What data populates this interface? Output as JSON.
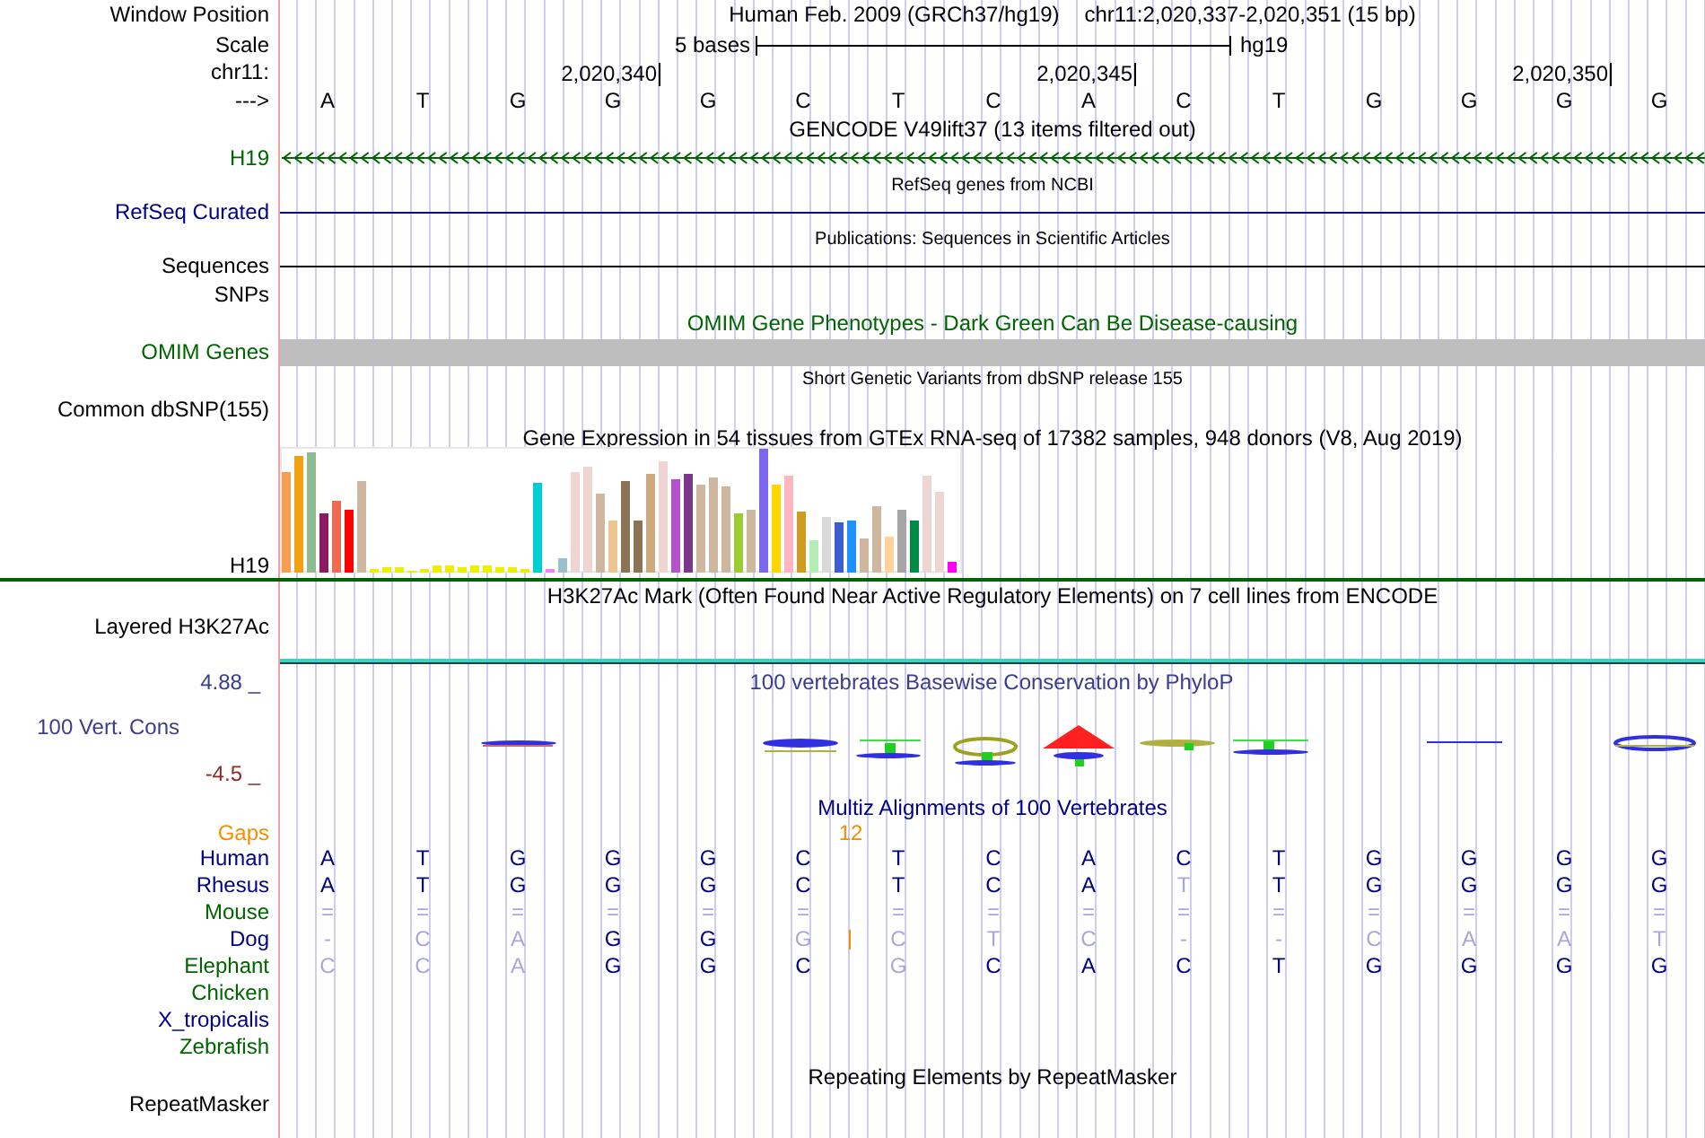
{
  "header": {
    "position_label": "Window Position",
    "assembly_name": "Human Feb. 2009 (GRCh37/hg19)",
    "location": "chr11:2,020,337-2,020,351 (15 bp)",
    "scale_label": "Scale",
    "scale_text": "5 bases",
    "assembly": "hg19",
    "chrom_label": "chr11:",
    "ticks": [
      "2,020,340",
      "2,020,345",
      "2,020,350"
    ],
    "strand_label": "--->",
    "bases": [
      "A",
      "T",
      "G",
      "G",
      "G",
      "C",
      "T",
      "C",
      "A",
      "C",
      "T",
      "G",
      "G",
      "G",
      "G"
    ]
  },
  "tracks": [
    {
      "kind": "gene",
      "title": {
        "text": "GENCODE V49lift37 (13 items filtered out)",
        "color": "#000000"
      },
      "label": "H19",
      "color": "#006400"
    },
    {
      "kind": "line",
      "title": {
        "text": "RefSeq genes from NCBI",
        "color": "#000000"
      },
      "label": "RefSeq Curated",
      "color": "#000080"
    },
    {
      "kind": "line",
      "title": {
        "text": "Publications: Sequences in Scientific Articles",
        "color": "#000000"
      },
      "label": "Sequences",
      "color": "#000000"
    },
    {
      "kind": "label",
      "label": "SNPs",
      "color": "#000000"
    },
    {
      "kind": "bar",
      "title": {
        "text": "OMIM Gene Phenotypes - Dark Green Can Be Disease-causing",
        "color": "#006400"
      },
      "label": "OMIM Genes",
      "color": "#006400"
    },
    {
      "kind": "snp",
      "title": {
        "text": "Short Genetic Variants from dbSNP release 155",
        "color": "#000000"
      },
      "label": "Common dbSNP(155)",
      "color": "#000000"
    },
    {
      "kind": "chart",
      "title": {
        "text": "Gene Expression in 54 tissues from GTEx RNA-seq of 17382 samples, 948 donors (V8, Aug 2019)",
        "color": "#000000"
      },
      "label": "H19",
      "color": "#000000"
    },
    {
      "kind": "signal",
      "title": {
        "text": "H3K27Ac Mark (Often Found Near Active Regulatory Elements) on 7 cell lines from ENCODE",
        "color": "#000000"
      },
      "label": "Layered H3K27Ac",
      "color": "#000000"
    },
    {
      "kind": "conservation",
      "title": {
        "text": "100 vertebrates Basewise Conservation by PhyloP",
        "color": "#3c3c8c"
      },
      "label": "100 Vert. Cons",
      "color": "#3c3c8c",
      "max": "4.88 _",
      "min": "-4.5 _"
    },
    {
      "kind": "alignment",
      "title": {
        "text": "Multiz Alignments of 100 Vertebrates",
        "color": "#000080"
      },
      "gaps": {
        "label": "Gaps",
        "text": "12"
      },
      "species": [
        {
          "name": "Human",
          "color": "#000080",
          "bases": [
            {
              "text": "A",
              "faded": false,
              "insert_after": false
            },
            {
              "text": "T",
              "faded": false,
              "insert_after": false
            },
            {
              "text": "G",
              "faded": false,
              "insert_after": false
            },
            {
              "text": "G",
              "faded": false,
              "insert_after": false
            },
            {
              "text": "G",
              "faded": false,
              "insert_after": false
            },
            {
              "text": "C",
              "faded": false,
              "insert_after": false
            },
            {
              "text": "T",
              "faded": false,
              "insert_after": false
            },
            {
              "text": "C",
              "faded": false,
              "insert_after": false
            },
            {
              "text": "A",
              "faded": false,
              "insert_after": false
            },
            {
              "text": "C",
              "faded": false,
              "insert_after": false
            },
            {
              "text": "T",
              "faded": false,
              "insert_after": false
            },
            {
              "text": "G",
              "faded": false,
              "insert_after": false
            },
            {
              "text": "G",
              "faded": false,
              "insert_after": false
            },
            {
              "text": "G",
              "faded": false,
              "insert_after": false
            },
            {
              "text": "G",
              "faded": false,
              "insert_after": false
            }
          ]
        },
        {
          "name": "Rhesus",
          "color": "#000080",
          "bases": [
            {
              "text": "A",
              "faded": false,
              "insert_after": false
            },
            {
              "text": "T",
              "faded": false,
              "insert_after": false
            },
            {
              "text": "G",
              "faded": false,
              "insert_after": false
            },
            {
              "text": "G",
              "faded": false,
              "insert_after": false
            },
            {
              "text": "G",
              "faded": false,
              "insert_after": false
            },
            {
              "text": "C",
              "faded": false,
              "insert_after": false
            },
            {
              "text": "T",
              "faded": false,
              "insert_after": false
            },
            {
              "text": "C",
              "faded": false,
              "insert_after": false
            },
            {
              "text": "A",
              "faded": false,
              "insert_after": false
            },
            {
              "text": "T",
              "faded": true,
              "insert_after": false
            },
            {
              "text": "T",
              "faded": false,
              "insert_after": false
            },
            {
              "text": "G",
              "faded": false,
              "insert_after": false
            },
            {
              "text": "G",
              "faded": false,
              "insert_after": false
            },
            {
              "text": "G",
              "faded": false,
              "insert_after": false
            },
            {
              "text": "G",
              "faded": false,
              "insert_after": false
            }
          ]
        },
        {
          "name": "Mouse",
          "color": "#006400",
          "bases": [
            {
              "text": "=",
              "faded": true,
              "insert_after": false
            },
            {
              "text": "=",
              "faded": true,
              "insert_after": false
            },
            {
              "text": "=",
              "faded": true,
              "insert_after": false
            },
            {
              "text": "=",
              "faded": true,
              "insert_after": false
            },
            {
              "text": "=",
              "faded": true,
              "insert_after": false
            },
            {
              "text": "=",
              "faded": true,
              "insert_after": false
            },
            {
              "text": "=",
              "faded": true,
              "insert_after": false
            },
            {
              "text": "=",
              "faded": true,
              "insert_after": false
            },
            {
              "text": "=",
              "faded": true,
              "insert_after": false
            },
            {
              "text": "=",
              "faded": true,
              "insert_after": false
            },
            {
              "text": "=",
              "faded": true,
              "insert_after": false
            },
            {
              "text": "=",
              "faded": true,
              "insert_after": false
            },
            {
              "text": "=",
              "faded": true,
              "insert_after": false
            },
            {
              "text": "=",
              "faded": true,
              "insert_after": false
            },
            {
              "text": "=",
              "faded": true,
              "insert_after": false
            }
          ]
        },
        {
          "name": "Dog",
          "color": "#000080",
          "bases": [
            {
              "text": "-",
              "faded": true,
              "insert_after": false
            },
            {
              "text": "C",
              "faded": true,
              "insert_after": false
            },
            {
              "text": "A",
              "faded": true,
              "insert_after": false
            },
            {
              "text": "G",
              "faded": false,
              "insert_after": false
            },
            {
              "text": "G",
              "faded": false,
              "insert_after": false
            },
            {
              "text": "G",
              "faded": true,
              "insert_after": true
            },
            {
              "text": "C",
              "faded": true,
              "insert_after": false
            },
            {
              "text": "T",
              "faded": true,
              "insert_after": false
            },
            {
              "text": "C",
              "faded": true,
              "insert_after": false
            },
            {
              "text": "-",
              "faded": true,
              "insert_after": false
            },
            {
              "text": "-",
              "faded": true,
              "insert_after": false
            },
            {
              "text": "C",
              "faded": true,
              "insert_after": false
            },
            {
              "text": "A",
              "faded": true,
              "insert_after": false
            },
            {
              "text": "A",
              "faded": true,
              "insert_after": false
            },
            {
              "text": "T",
              "faded": true,
              "insert_after": false
            }
          ]
        },
        {
          "name": "Elephant",
          "color": "#006400",
          "bases": [
            {
              "text": "C",
              "faded": true,
              "insert_after": false
            },
            {
              "text": "C",
              "faded": true,
              "insert_after": false
            },
            {
              "text": "A",
              "faded": true,
              "insert_after": false
            },
            {
              "text": "G",
              "faded": false,
              "insert_after": false
            },
            {
              "text": "G",
              "faded": false,
              "insert_after": false
            },
            {
              "text": "C",
              "faded": false,
              "insert_after": false
            },
            {
              "text": "G",
              "faded": true,
              "insert_after": false
            },
            {
              "text": "C",
              "faded": false,
              "insert_after": false
            },
            {
              "text": "A",
              "faded": false,
              "insert_after": false
            },
            {
              "text": "C",
              "faded": false,
              "insert_after": false
            },
            {
              "text": "T",
              "faded": false,
              "insert_after": false
            },
            {
              "text": "G",
              "faded": false,
              "insert_after": false
            },
            {
              "text": "G",
              "faded": false,
              "insert_after": false
            },
            {
              "text": "G",
              "faded": false,
              "insert_after": false
            },
            {
              "text": "G",
              "faded": false,
              "insert_after": false
            }
          ]
        },
        {
          "name": "Chicken",
          "color": "#006400"
        },
        {
          "name": "X_tropicalis",
          "color": "#000080"
        },
        {
          "name": "Zebrafish",
          "color": "#006400"
        }
      ]
    },
    {
      "kind": "repeats",
      "title": {
        "text": "Repeating Elements by RepeatMasker",
        "color": "#000000"
      },
      "label": "RepeatMasker",
      "color": "#000000"
    }
  ]
}
